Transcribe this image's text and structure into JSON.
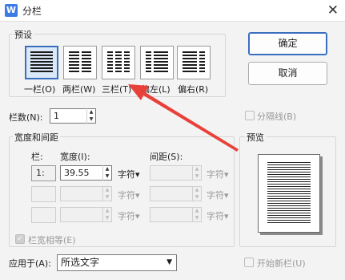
{
  "window": {
    "title": "分栏",
    "app_icon_letter": "W",
    "close_glyph": "✕"
  },
  "preset_group": {
    "label": "预设",
    "items": [
      {
        "label": "一栏(O)",
        "columns": 1
      },
      {
        "label": "两栏(W)",
        "columns": 2
      },
      {
        "label": "三栏(T)",
        "columns": 3
      },
      {
        "label": "偏左(L)",
        "columns": 2
      },
      {
        "label": "偏右(R)",
        "columns": 2
      }
    ],
    "selected_index": 0
  },
  "buttons": {
    "ok": "确定",
    "cancel": "取消"
  },
  "column_count": {
    "label": "栏数(N):",
    "value": "1"
  },
  "separator": {
    "label": "分隔线(B)"
  },
  "width_spacing": {
    "label": "宽度和间距",
    "col_header": "栏:",
    "width_header": "宽度(I):",
    "spacing_header": "间距(S):",
    "rows": [
      {
        "col": "1:",
        "width": "39.55",
        "width_unit": "字符▾",
        "spacing": "",
        "spacing_unit": "字符▾"
      },
      {
        "col": "",
        "width": "",
        "width_unit": "字符▾",
        "spacing": "",
        "spacing_unit": "字符▾"
      },
      {
        "col": "",
        "width": "",
        "width_unit": "字符▾",
        "spacing": "",
        "spacing_unit": "字符▾"
      }
    ],
    "equal_width": "栏宽相等(E)"
  },
  "preview": {
    "label": "预览"
  },
  "apply_to": {
    "label": "应用于(A):",
    "value": "所选文字"
  },
  "new_column": {
    "label": "开始新栏(U)"
  },
  "colors": {
    "accent": "#3a6fbf",
    "annotation_arrow": "#e8413a"
  }
}
